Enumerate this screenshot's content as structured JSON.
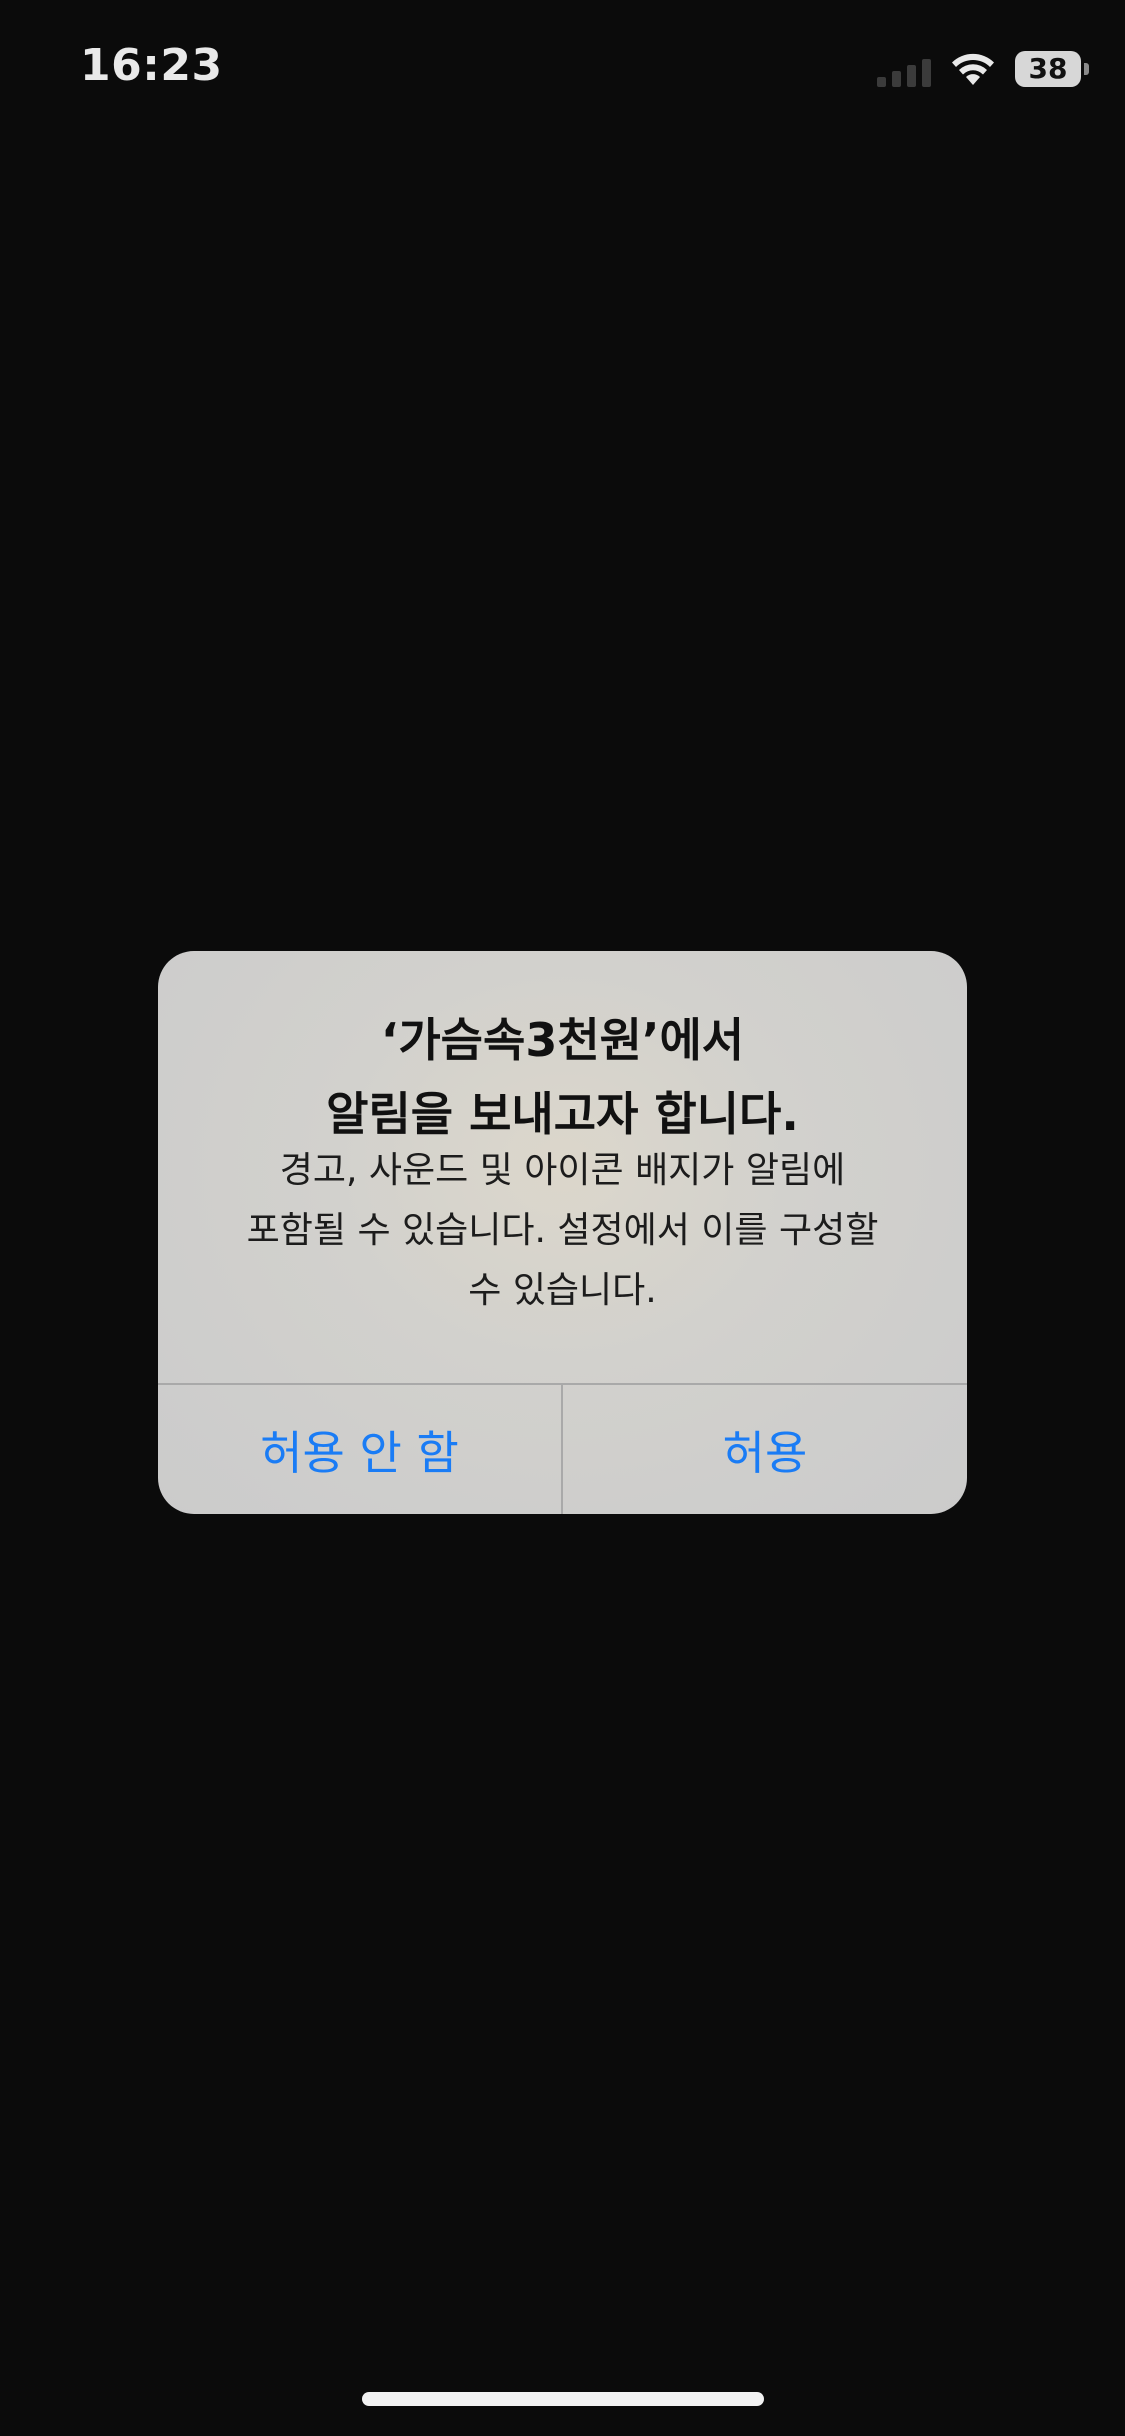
{
  "status_bar": {
    "time": "16:23",
    "battery_level": "38"
  },
  "alert": {
    "title_line1": "‘가슴속3천원’에서",
    "title_line2": "알림을 보내고자 합니다.",
    "message_line1": "경고, 사운드 및 아이콘 배지가 알림에",
    "message_line2": "포함될 수 있습니다. 설정에서 이를 구성할",
    "message_line3": "수 있습니다.",
    "deny_label": "허용 안 함",
    "allow_label": "허용"
  },
  "colors": {
    "background": "#0b0b0b",
    "alert_button_text": "#1a7cf5",
    "alert_background": "#d0d0ce"
  }
}
